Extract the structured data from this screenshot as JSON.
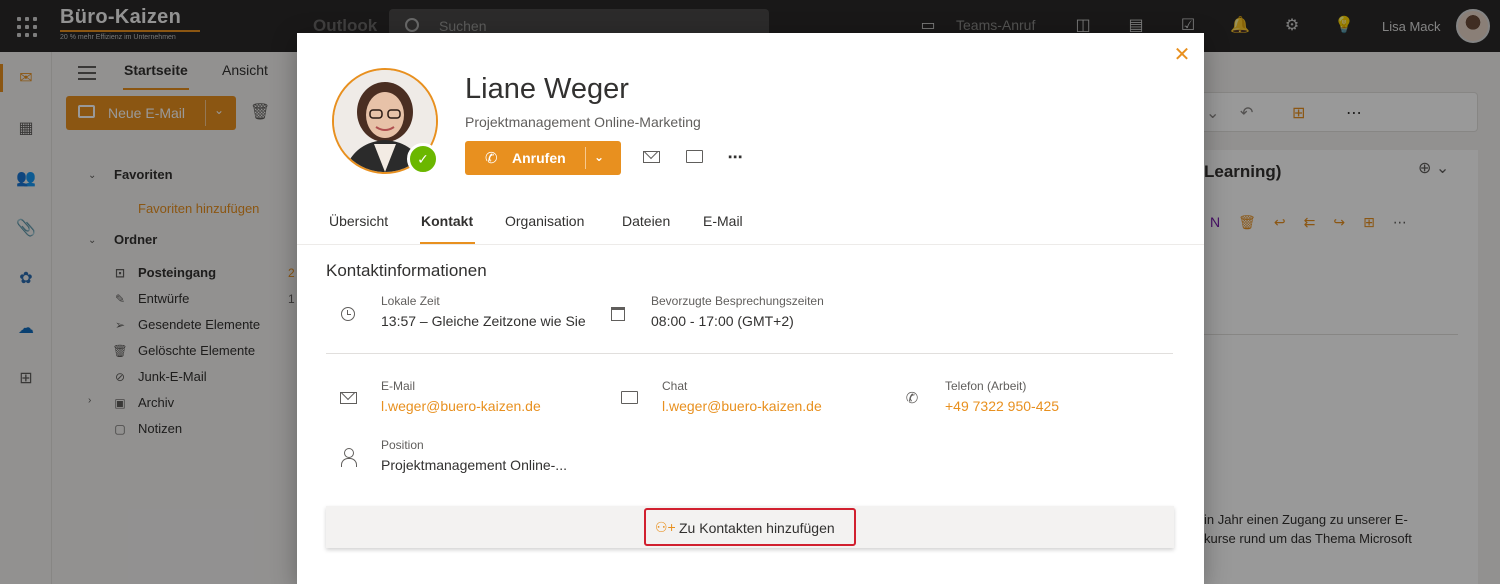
{
  "topbar": {
    "brand_name": "Büro-Kaizen",
    "brand_tagline": "20 % mehr Effizienz im Unternehmen",
    "app_name": "Outlook",
    "search_placeholder": "Suchen",
    "teams_call": "Teams-Anruf",
    "user_name": "Lisa Mack"
  },
  "ribbon": {
    "tabs": [
      "Startseite",
      "Ansicht"
    ],
    "new_mail": "Neue E-Mail"
  },
  "folders": {
    "favorites_header": "Favoriten",
    "favorites_add": "Favoriten hinzufügen",
    "folders_header": "Ordner",
    "items": [
      {
        "label": "Posteingang",
        "icon": "inbox-icon",
        "count": "2"
      },
      {
        "label": "Entwürfe",
        "icon": "draft-icon",
        "count": "1"
      },
      {
        "label": "Gesendete Elemente",
        "icon": "sent-icon",
        "count": ""
      },
      {
        "label": "Gelöschte Elemente",
        "icon": "trash-icon",
        "count": ""
      },
      {
        "label": "Junk-E-Mail",
        "icon": "junk-icon",
        "count": ""
      },
      {
        "label": "Archiv",
        "icon": "archive-icon",
        "count": ""
      },
      {
        "label": "Notizen",
        "icon": "notes-icon",
        "count": ""
      }
    ]
  },
  "reading_pane": {
    "title_fragment": "Learning)",
    "text_line1": "in Jahr einen Zugang zu unserer E-",
    "text_line2": "kurse rund um das Thema Microsoft"
  },
  "contact": {
    "name": "Liane Weger",
    "job_title": "Projektmanagement Online-Marketing",
    "call_label": "Anrufen",
    "tabs": [
      "Übersicht",
      "Kontakt",
      "Organisation",
      "Dateien",
      "E-Mail"
    ],
    "active_tab": "Kontakt",
    "section_title": "Kontaktinformationen",
    "local_time_label": "Lokale Zeit",
    "local_time_value": "13:57 – Gleiche Zeitzone wie Sie",
    "meeting_label": "Bevorzugte Besprechungszeiten",
    "meeting_value": "08:00 - 17:00 (GMT+2)",
    "email_label": "E-Mail",
    "email_value": "l.weger@buero-kaizen.de",
    "chat_label": "Chat",
    "chat_value": "l.weger@buero-kaizen.de",
    "phone_label": "Telefon (Arbeit)",
    "phone_value": "+49 7322 950-425",
    "position_label": "Position",
    "position_value": "Projektmanagement Online-...",
    "add_contacts": "Zu Kontakten hinzufügen"
  },
  "colors": {
    "accent": "#e8901f",
    "topbar": "#2a2928",
    "presence": "#6bb700",
    "highlight": "#d1202f"
  }
}
